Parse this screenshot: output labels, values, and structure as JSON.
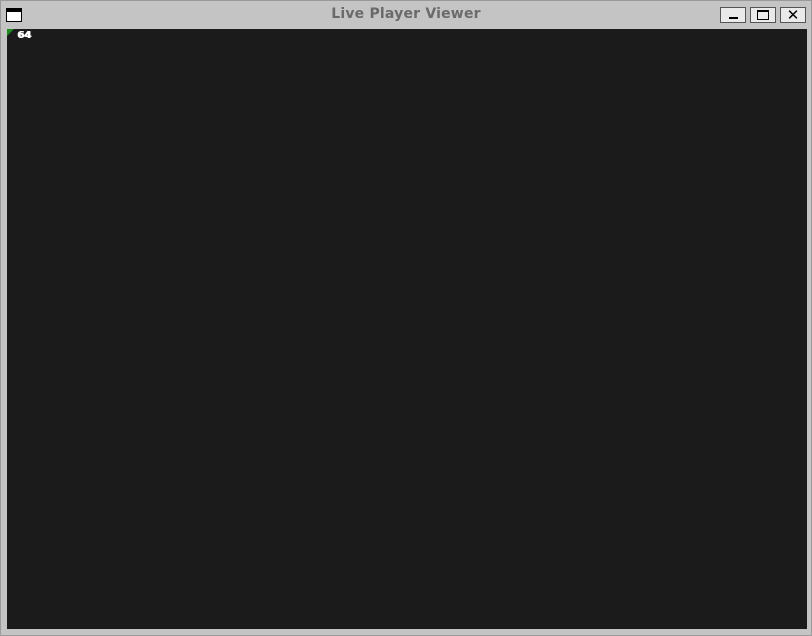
{
  "window": {
    "title": "Live Player Viewer",
    "controls": {
      "minimize_icon": "minimize-icon",
      "maximize_icon": "maximize-icon",
      "close_glyph": "✕"
    }
  },
  "viewport": {
    "background": "#1b1b1b",
    "players": [
      {
        "label": "64",
        "marker_color": "#1f8a1f"
      },
      {
        "label": "64",
        "marker_color": "#1f8a1f"
      }
    ]
  }
}
